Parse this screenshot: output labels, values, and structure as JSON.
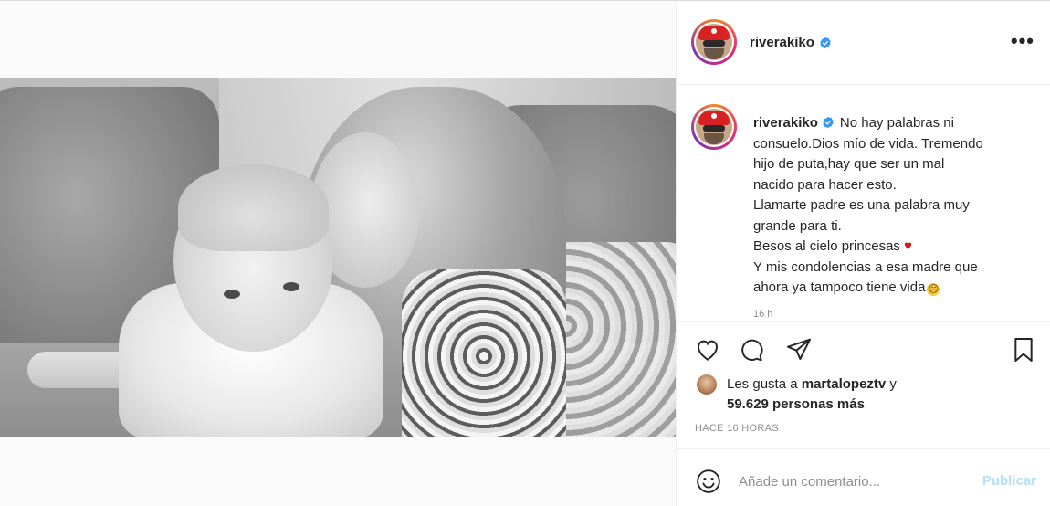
{
  "post": {
    "username": "riverakiko",
    "verified": true,
    "caption_lines": [
      "No hay palabras ni",
      "consuelo.Dios mío de vida. Tremendo",
      "hijo de puta,hay que ser un mal",
      "nacido para hacer esto.",
      "Llamarte padre es una palabra muy",
      "grande para ti.",
      "Besos al cielo princesas",
      "Y mis condolencias a esa madre que",
      "ahora ya tampoco tiene vida"
    ],
    "caption_heart": "♥",
    "caption_emoji": "☹",
    "caption_timestamp": "16 h",
    "more_label": "•••"
  },
  "likes": {
    "prefix": "Les gusta a ",
    "first_user": "martalopeztv",
    "connector": " y",
    "count_text": "59.629 personas más"
  },
  "time_label": "HACE 16 HORAS",
  "comment": {
    "placeholder": "Añade un comentario...",
    "publish_label": "Publicar"
  },
  "icons": {
    "like": "heart-outline-icon",
    "comment": "speech-bubble-icon",
    "share": "paper-plane-icon",
    "save": "bookmark-icon",
    "emoji": "smiley-icon",
    "verified": "verified-badge-icon",
    "more": "more-options-icon"
  },
  "colors": {
    "verified_blue": "#3897f0",
    "publish_disabled": "#b2dffc",
    "heart_red": "#d11a1a",
    "muted_text": "#8e8e8e"
  }
}
